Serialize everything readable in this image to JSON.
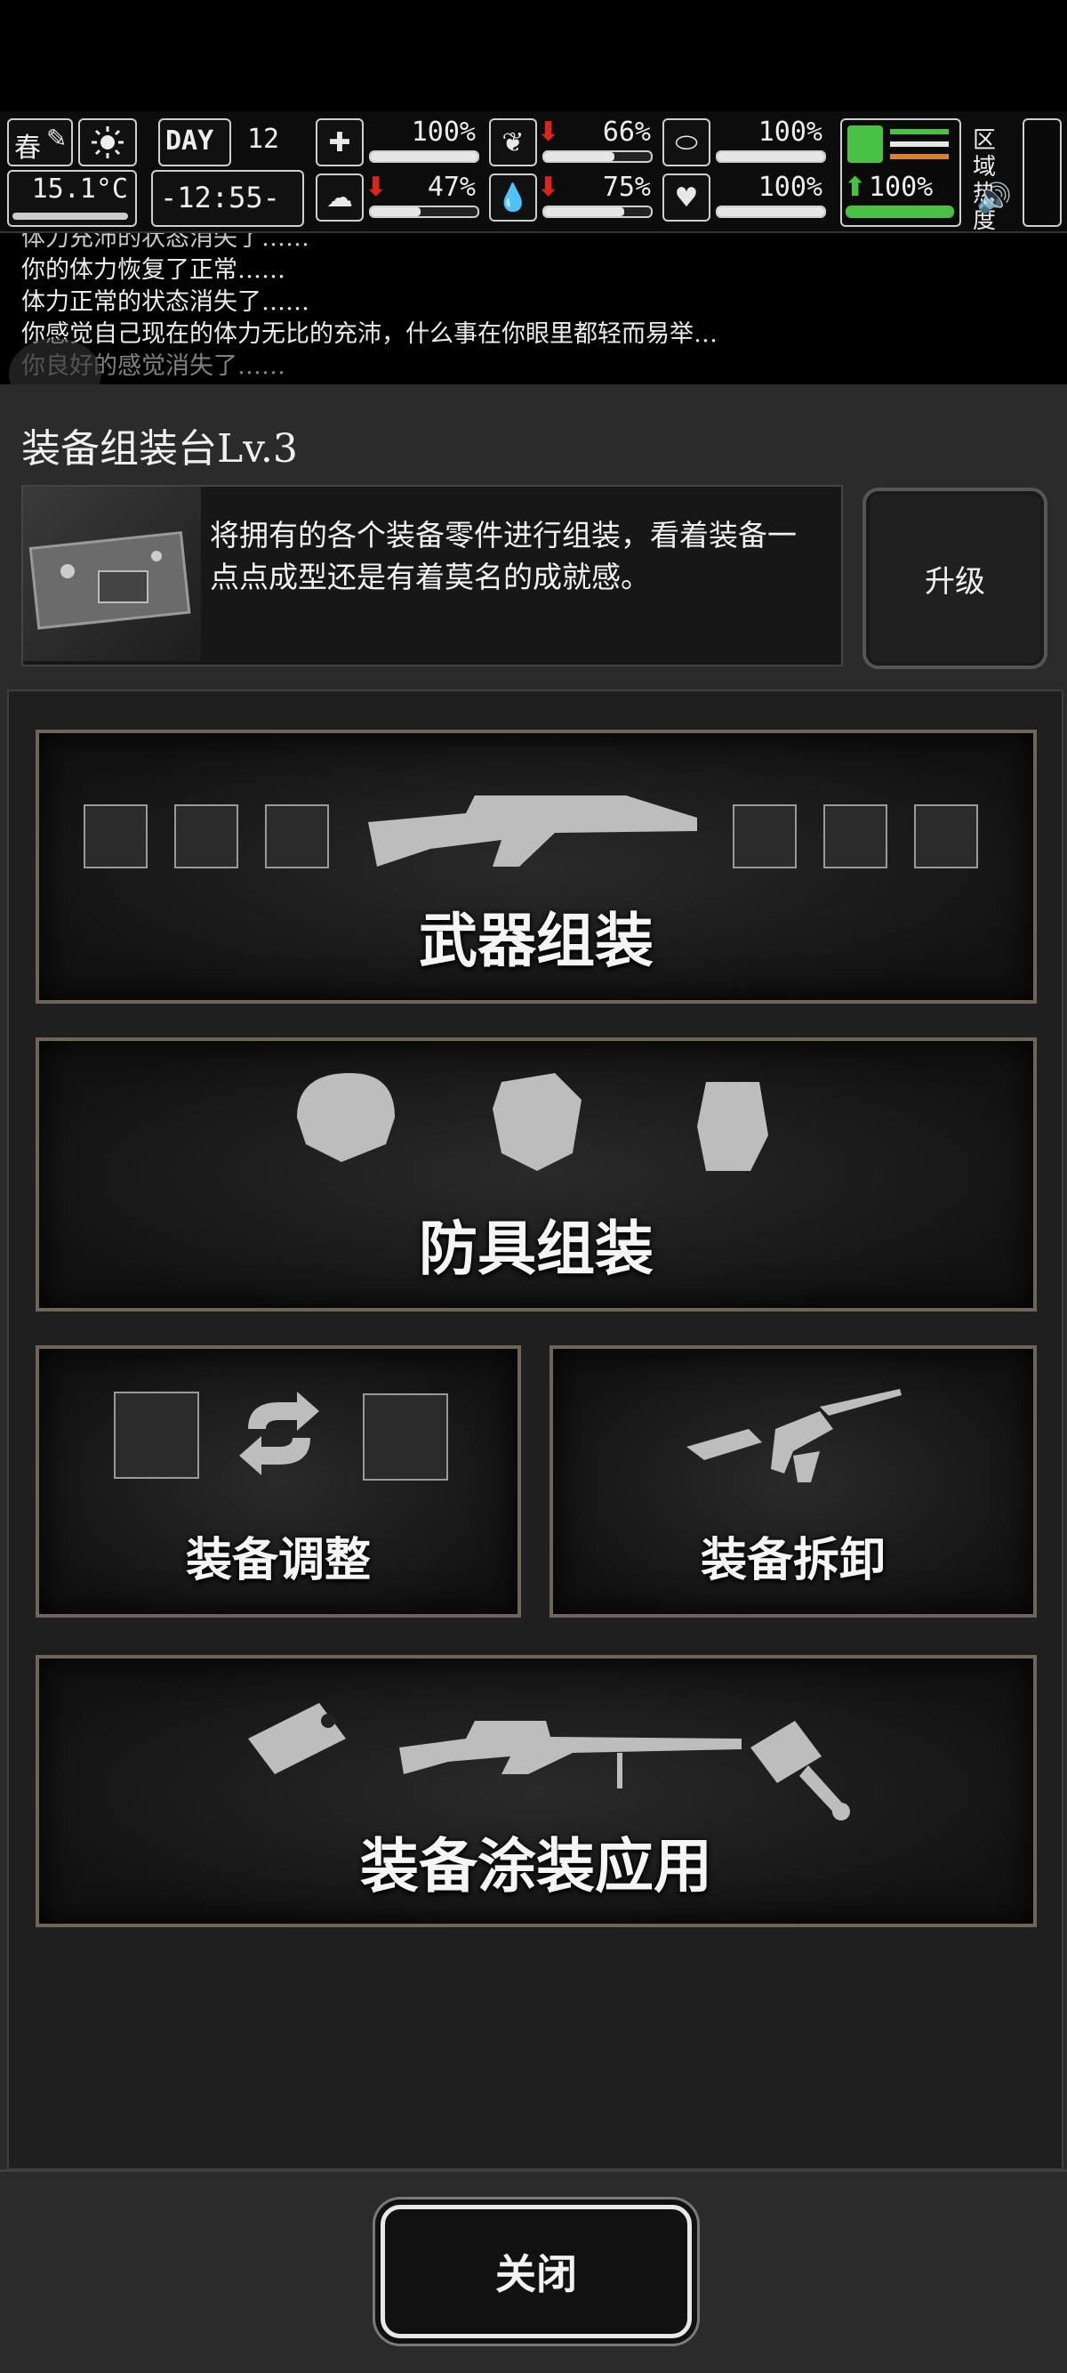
{
  "hud": {
    "season": "春",
    "day_label": "DAY",
    "day": "12",
    "temperature": "15.1°C",
    "clock": "-12:55-",
    "stats_row1": [
      {
        "icon": "medkit-icon",
        "value": "100%",
        "level": 1.0
      },
      {
        "icon": "stomach-icon",
        "value": "66%",
        "level": 0.66,
        "trend": "down"
      },
      {
        "icon": "mask-icon",
        "value": "100%",
        "level": 1.0
      }
    ],
    "stats_row2": [
      {
        "icon": "brain-icon",
        "value": "47%",
        "level": 0.47,
        "trend": "down"
      },
      {
        "icon": "water-drop-icon",
        "value": "75%",
        "level": 0.75,
        "trend": "down"
      },
      {
        "icon": "heart-icon",
        "value": "100%",
        "level": 1.0
      }
    ],
    "stamina_value": "100%",
    "zone_label": "区域热度",
    "colors": {
      "red": "#d8261f",
      "green": "#48c144",
      "orange": "#d9822b"
    }
  },
  "log": [
    "体力充沛的状态消失了……",
    "你的体力恢复了正常……",
    "体力正常的状态消失了……",
    "你感觉自己现在的体力无比的充沛，什么事在你眼里都轻而易举…",
    "你良好的感觉消失了……"
  ],
  "panel": {
    "title": "装备组装台Lv.3",
    "description": "将拥有的各个装备零件进行组装，看着装备一点点成型还是有着莫名的成就感。",
    "upgrade_label": "升级"
  },
  "cards": {
    "weapon": "武器组装",
    "armor": "防具组装",
    "adjust": "装备调整",
    "disassemble": "装备拆卸",
    "paint": "装备涂装应用"
  },
  "close_label": "关闭"
}
